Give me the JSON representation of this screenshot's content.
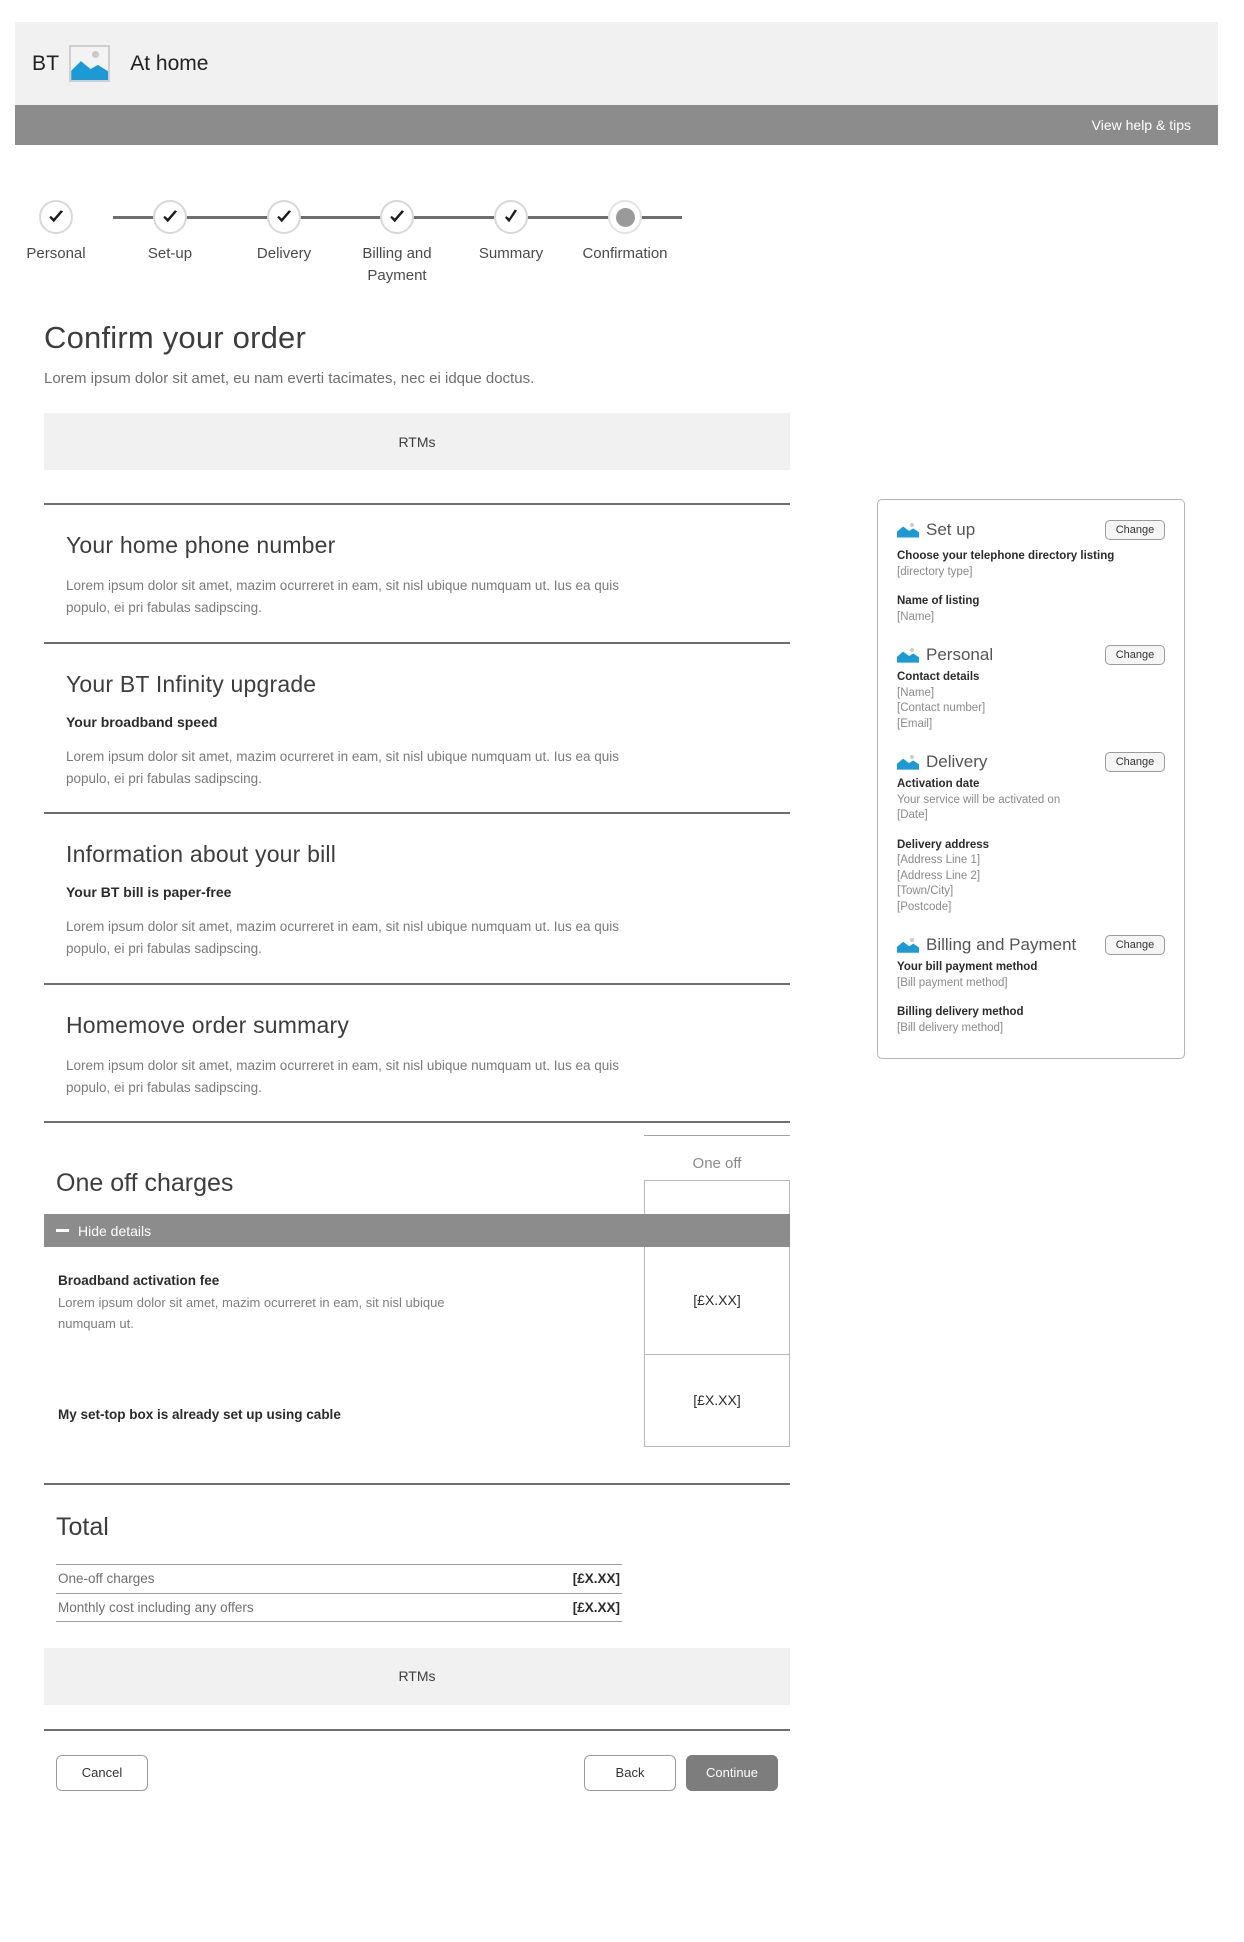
{
  "header": {
    "brand_code": "BT",
    "logo_icon": "broken-image-icon",
    "title": "At home",
    "help_link": "View help & tips"
  },
  "stepper": {
    "steps": [
      {
        "label": "Personal",
        "state": "complete",
        "icon": "check-icon"
      },
      {
        "label": "Set-up",
        "state": "complete",
        "icon": "check-icon"
      },
      {
        "label": "Delivery",
        "state": "complete",
        "icon": "check-icon"
      },
      {
        "label": "Billing and Payment",
        "state": "complete",
        "icon": "check-icon"
      },
      {
        "label": "Summary",
        "state": "current",
        "icon": "check-icon"
      },
      {
        "label": "Confirmation",
        "state": "pending",
        "icon": "dot-icon"
      }
    ]
  },
  "page": {
    "title": "Confirm your order",
    "subtitle": "Lorem ipsum dolor sit amet, eu nam everti tacimates, nec ei idque doctus.",
    "rtm_top": "RTMs",
    "rtm_bottom": "RTMs",
    "body_text": "Lorem ipsum dolor sit amet, mazim ocurreret in eam, sit nisl ubique numquam ut. Ius ea quis populo, ei pri fabulas sadipscing."
  },
  "sections": [
    {
      "heading": "Your home phone number",
      "subheading": "",
      "body": "Lorem ipsum dolor sit amet, mazim ocurreret in eam, sit nisl ubique numquam ut. Ius ea quis populo, ei pri fabulas sadipscing."
    },
    {
      "heading": "Your BT Infinity upgrade",
      "subheading": "Your broadband speed",
      "body": "Lorem ipsum dolor sit amet, mazim ocurreret in eam, sit nisl ubique numquam ut. Ius ea quis populo, ei pri fabulas sadipscing."
    },
    {
      "heading": "Information about your bill",
      "subheading": "Your BT bill is paper-free",
      "body": "Lorem ipsum dolor sit amet, mazim ocurreret in eam, sit nisl ubique numquam ut. Ius ea quis populo, ei pri fabulas sadipscing."
    },
    {
      "heading": "Homemove order summary",
      "subheading": "",
      "body": "Lorem ipsum dolor sit amet, mazim ocurreret in eam, sit nisl ubique numquam ut. Ius ea quis populo, ei pri fabulas sadipscing."
    }
  ],
  "charges": {
    "title": "One off charges",
    "column_header": "One off",
    "toggle_label": "Hide details",
    "toggle_icon": "minus-icon",
    "rows": [
      {
        "name": "Broadband activation fee",
        "blurb": "Lorem ipsum dolor sit amet, mazim ocurreret in eam, sit nisl ubique numquam ut.",
        "amount": "[£X.XX]"
      },
      {
        "name": "My set-top box is already set up using cable",
        "blurb": "",
        "amount": "[£X.XX]"
      }
    ]
  },
  "total": {
    "title": "Total",
    "rows": [
      {
        "label": "One-off charges",
        "amount": "[£X.XX]"
      },
      {
        "label": "Monthly cost including any offers",
        "amount": "[£X.XX]"
      }
    ]
  },
  "footer": {
    "cancel": "Cancel",
    "back": "Back",
    "continue": "Continue"
  },
  "summary_panel": {
    "change_label": "Change",
    "groups": [
      {
        "title": "Set up",
        "icon": "broken-image-icon",
        "blocks": [
          {
            "label": "Choose your telephone directory listing",
            "value": "[directory type]"
          },
          {
            "label": "Name of listing",
            "value": "[Name]"
          }
        ]
      },
      {
        "title": "Personal",
        "icon": "broken-image-icon",
        "blocks": [
          {
            "label": "Contact details",
            "value": "[Name]\n[Contact number]\n[Email]"
          }
        ]
      },
      {
        "title": "Delivery",
        "icon": "broken-image-icon",
        "blocks": [
          {
            "label": "Activation date",
            "value": "Your service will be activated on\n[Date]"
          },
          {
            "label": "Delivery address",
            "value": "[Address Line 1]\n[Address Line 2]\n[Town/City]\n[Postcode]"
          }
        ]
      },
      {
        "title": "Billing and Payment",
        "icon": "broken-image-icon",
        "blocks": [
          {
            "label": "Your bill payment method",
            "value": "[Bill payment method]"
          },
          {
            "label": "Billing delivery method",
            "value": "[Bill delivery method]"
          }
        ]
      }
    ]
  },
  "colors": {
    "brand_blue": "#1c9ad6",
    "bar_gray": "#8c8c8c",
    "panel_gray": "#f1f1f1"
  }
}
